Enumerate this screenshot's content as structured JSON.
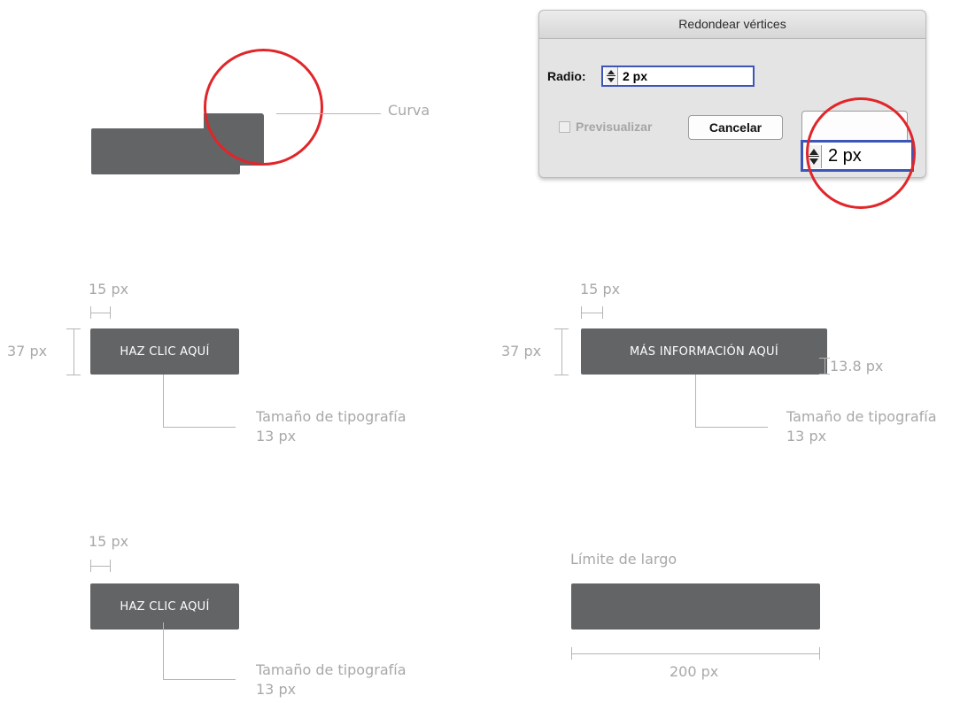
{
  "callouts": {
    "curve": "Curva",
    "length_limit": "Límite de largo",
    "length_value": "200 px"
  },
  "dialog": {
    "title": "Redondear vértices",
    "radius_label": "Radio:",
    "radius_value": "2 px",
    "preview_label": "Previsualizar",
    "cancel_label": "Cancelar",
    "zoom_value": "2 px"
  },
  "examples": [
    {
      "padding": "15 px",
      "height": "37 px",
      "button_label": "HAZ CLIC AQUÍ",
      "font_size_title": "Tamaño de tipografía",
      "font_size_value": "13 px"
    },
    {
      "padding": "15 px",
      "height": "37 px",
      "button_label": "MÁS INFORMACIÓN AQUÍ",
      "vertical_padding": "13.8 px",
      "font_size_title": "Tamaño de tipografía",
      "font_size_value": "13 px"
    },
    {
      "padding": "15 px",
      "button_label": "HAZ CLIC AQUÍ",
      "font_size_title": "Tamaño de tipografía",
      "font_size_value": "13 px"
    }
  ],
  "colors": {
    "button_fill": "#636466",
    "annotation": "#a8a8a8",
    "highlight_circle": "#e0262a",
    "input_border": "#3b55b8"
  }
}
